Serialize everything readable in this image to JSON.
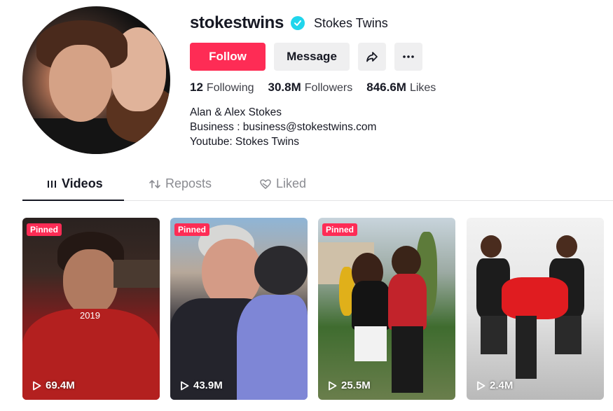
{
  "profile": {
    "username": "stokestwins",
    "display_name": "Stokes Twins",
    "verified_icon": "check-badge-icon",
    "buttons": {
      "follow": "Follow",
      "message": "Message",
      "share_icon": "share-arrow-icon",
      "more_icon": "more-dots-icon"
    },
    "stats": {
      "following": {
        "value": "12",
        "label": "Following"
      },
      "followers": {
        "value": "30.8M",
        "label": "Followers"
      },
      "likes": {
        "value": "846.6M",
        "label": "Likes"
      }
    },
    "bio": [
      "Alan & Alex Stokes",
      "Business : business@stokestwins.com",
      "Youtube: Stokes Twins"
    ]
  },
  "tabs": [
    {
      "label": "Videos",
      "icon": "grid-icon",
      "active": true
    },
    {
      "label": "Reposts",
      "icon": "repost-icon",
      "active": false
    },
    {
      "label": "Liked",
      "icon": "heart-slash-icon",
      "active": false
    }
  ],
  "videos": [
    {
      "pinned": "Pinned",
      "overlay_text": "2019",
      "plays": "69.4M"
    },
    {
      "pinned": "Pinned",
      "plays": "43.9M"
    },
    {
      "pinned": "Pinned",
      "plays": "25.5M"
    },
    {
      "plays": "2.4M"
    }
  ],
  "colors": {
    "accent": "#fe2c55",
    "verified": "#20d5ec",
    "button_bg": "#efeff0"
  }
}
